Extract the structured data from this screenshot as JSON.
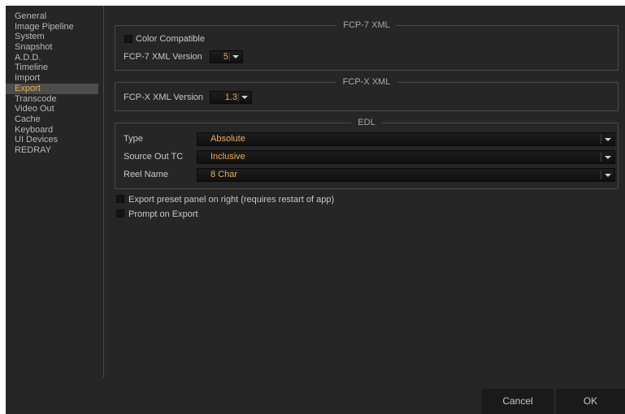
{
  "sidebar": {
    "items": [
      {
        "label": "General"
      },
      {
        "label": "Image Pipeline"
      },
      {
        "label": "System"
      },
      {
        "label": "Snapshot"
      },
      {
        "label": "A.D.D."
      },
      {
        "label": "Timeline"
      },
      {
        "label": "Import"
      },
      {
        "label": "Export",
        "selected": true
      },
      {
        "label": "Transcode"
      },
      {
        "label": "Video Out"
      },
      {
        "label": "Cache"
      },
      {
        "label": "Keyboard"
      },
      {
        "label": "UI Devices"
      },
      {
        "label": "REDRAY"
      }
    ]
  },
  "fcp7": {
    "title": "FCP-7 XML",
    "color_compatible_label": "Color Compatible",
    "color_compatible_checked": false,
    "version_label": "FCP-7 XML Version",
    "version_value": "5"
  },
  "fcpx": {
    "title": "FCP-X XML",
    "version_label": "FCP-X XML Version",
    "version_value": "1.3"
  },
  "edl": {
    "title": "EDL",
    "type_label": "Type",
    "type_value": "Absolute",
    "source_out_label": "Source Out TC",
    "source_out_value": "Inclusive",
    "reel_name_label": "Reel Name",
    "reel_name_value": "8 Char"
  },
  "options": {
    "export_preset_label": "Export preset panel on right (requires restart of app)",
    "export_preset_checked": false,
    "prompt_on_export_label": "Prompt on Export",
    "prompt_on_export_checked": false
  },
  "buttons": {
    "cancel": "Cancel",
    "ok": "OK"
  },
  "colors": {
    "accent": "#e9b04b",
    "background": "#262626",
    "selected_bg": "#4d4d4d"
  }
}
